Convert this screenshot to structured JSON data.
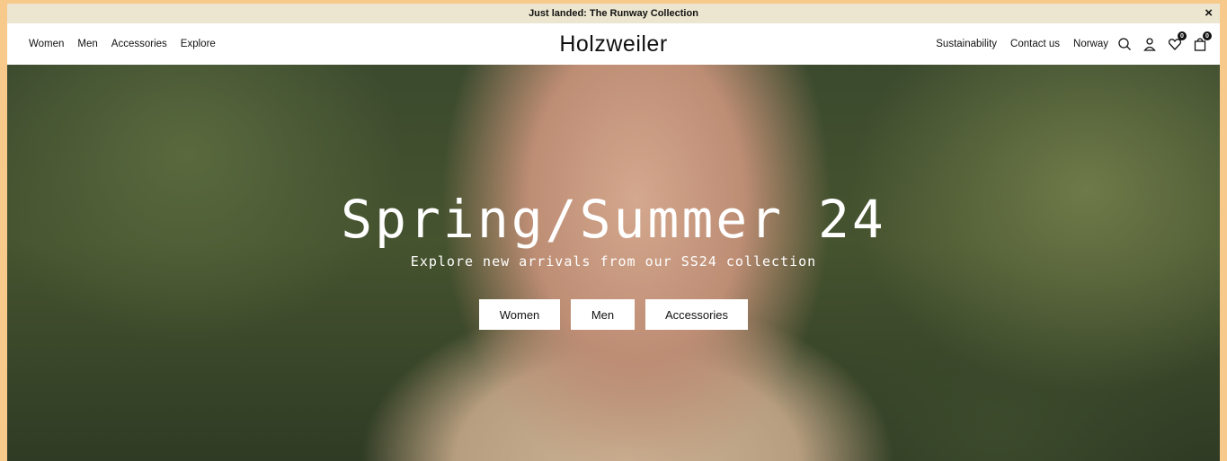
{
  "announcement": {
    "text": "Just landed: The Runway Collection",
    "close_label": "×"
  },
  "header": {
    "logo": "Holzweiler",
    "nav_left": [
      {
        "label": "Women"
      },
      {
        "label": "Men"
      },
      {
        "label": "Accessories"
      },
      {
        "label": "Explore"
      }
    ],
    "nav_right": [
      {
        "label": "Sustainability"
      },
      {
        "label": "Contact us"
      },
      {
        "label": "Norway"
      }
    ],
    "icons": {
      "search": "search-icon",
      "account": "user-icon",
      "wishlist": {
        "icon": "heart-icon",
        "count": "0"
      },
      "bag": {
        "icon": "shopping-bag-icon",
        "count": "0"
      }
    }
  },
  "hero": {
    "title": "Spring/Summer 24",
    "subtitle": "Explore new arrivals from our SS24 collection",
    "buttons": [
      {
        "label": "Women"
      },
      {
        "label": "Men"
      },
      {
        "label": "Accessories"
      }
    ]
  },
  "colors": {
    "page_border": "#f7c98a",
    "announcement_bg": "#ece6d0",
    "text": "#111111"
  }
}
